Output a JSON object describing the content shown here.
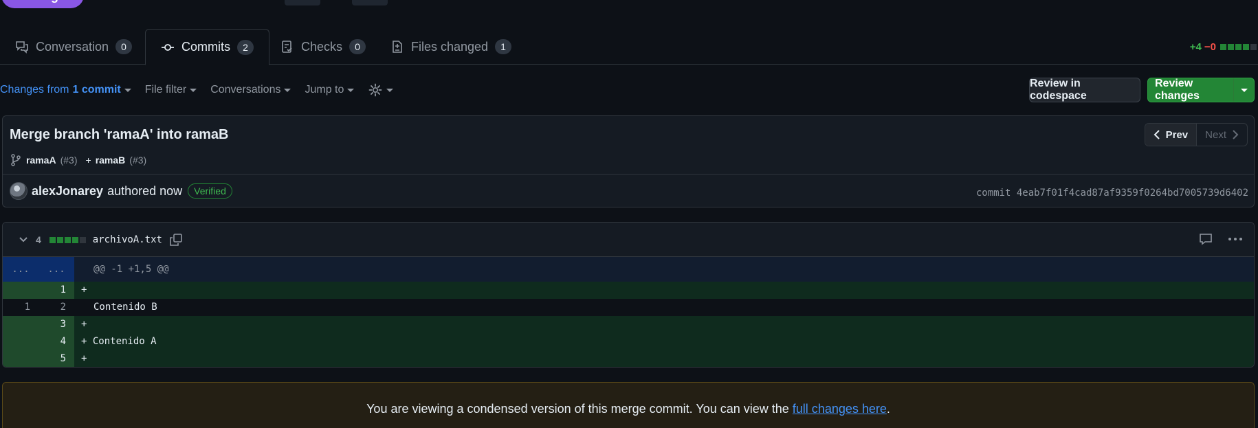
{
  "status": {
    "label": "Merged"
  },
  "tabs": [
    {
      "label": "Conversation",
      "count": "0"
    },
    {
      "label": "Commits",
      "count": "2"
    },
    {
      "label": "Checks",
      "count": "0"
    },
    {
      "label": "Files changed",
      "count": "1"
    }
  ],
  "diffstat": {
    "additions": "+4",
    "deletions": "−0"
  },
  "toolbar": {
    "changes_prefix": "Changes from",
    "changes_link": "1 commit",
    "file_filter": "File filter",
    "conversations": "Conversations",
    "jump_to": "Jump to"
  },
  "buttons": {
    "codespace": "Review in codespace",
    "review": "Review changes"
  },
  "commit": {
    "title": "Merge branch 'ramaA' into ramaB",
    "branch_a": "ramaA",
    "branch_a_ref": "(#3)",
    "plus": "+",
    "branch_b": "ramaB",
    "branch_b_ref": "(#3)",
    "author": "alexJonarey",
    "authored": "authored now",
    "verified": "Verified",
    "sha": "commit 4eab7f01f4cad87af9359f0264bd7005739d6402",
    "prev": "Prev",
    "next": "Next"
  },
  "file": {
    "changes": "4",
    "name": "archivoA.txt",
    "hunk_old": "...",
    "hunk_new": "...",
    "hunk": "@@ -1 +1,5 @@",
    "lines": [
      {
        "old": "",
        "new": "1",
        "type": "add",
        "text": "+ "
      },
      {
        "old": "1",
        "new": "2",
        "type": "ctx",
        "text": "Contenido B"
      },
      {
        "old": "",
        "new": "3",
        "type": "add",
        "text": "+ "
      },
      {
        "old": "",
        "new": "4",
        "type": "add",
        "text": "+ Contenido A"
      },
      {
        "old": "",
        "new": "5",
        "type": "add",
        "text": "+ "
      }
    ]
  },
  "notice": {
    "text": "You are viewing a condensed version of this merge commit. You can view the",
    "link": "full changes here",
    "end": "."
  }
}
